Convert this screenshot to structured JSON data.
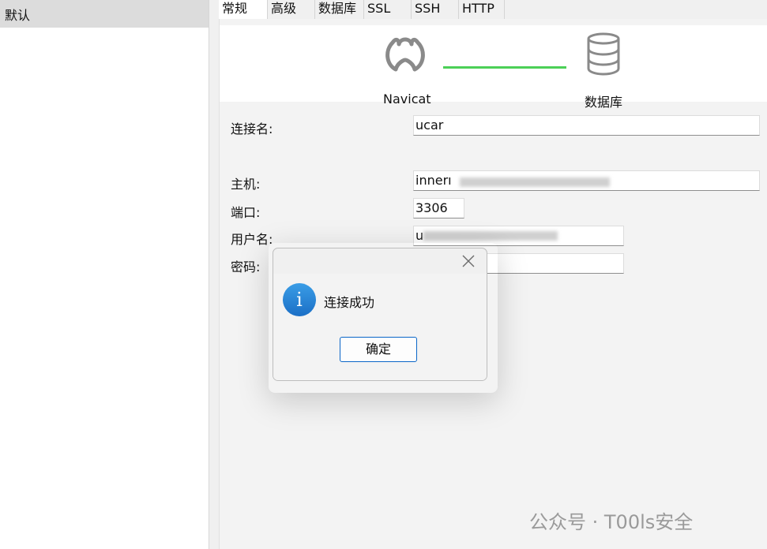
{
  "sidebar": {
    "item_label": "默认"
  },
  "tabs": [
    "常规",
    "高级",
    "数据库",
    "SSL",
    "SSH",
    "HTTP"
  ],
  "diagram": {
    "left_label": "Navicat",
    "right_label": "数据库",
    "link_color": "#4cd057"
  },
  "form": {
    "connection_name_label": "连接名:",
    "connection_name_value": "ucar",
    "host_label": "主机:",
    "host_value": "innerı",
    "port_label": "端口:",
    "port_value": "3306",
    "username_label": "用户名:",
    "username_value": "u",
    "password_label": "密码:"
  },
  "dialog": {
    "message": "连接成功",
    "ok_label": "确定",
    "icon": "info-icon"
  },
  "watermark": {
    "text": "公众号 · T00ls安全"
  }
}
